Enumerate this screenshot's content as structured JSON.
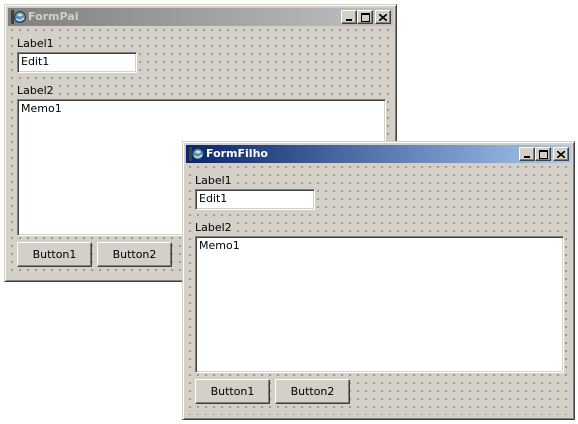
{
  "colors": {
    "face": "#d4d0c8",
    "active_title_start": "#0a246a",
    "active_title_end": "#a6caf0",
    "inactive_title_start": "#808080",
    "inactive_title_end": "#c0c0c0"
  },
  "form_pai": {
    "title": "FormPai",
    "icon": "delphi-app-icon",
    "label1": "Label1",
    "edit1": "Edit1",
    "label2": "Label2",
    "memo1": "Memo1",
    "button1": "Button1",
    "button2": "Button2"
  },
  "form_filho": {
    "title": "FormFilho",
    "icon": "delphi-app-icon",
    "label1": "Label1",
    "edit1": "Edit1",
    "label2": "Label2",
    "memo1": "Memo1",
    "button1": "Button1",
    "button2": "Button2"
  }
}
